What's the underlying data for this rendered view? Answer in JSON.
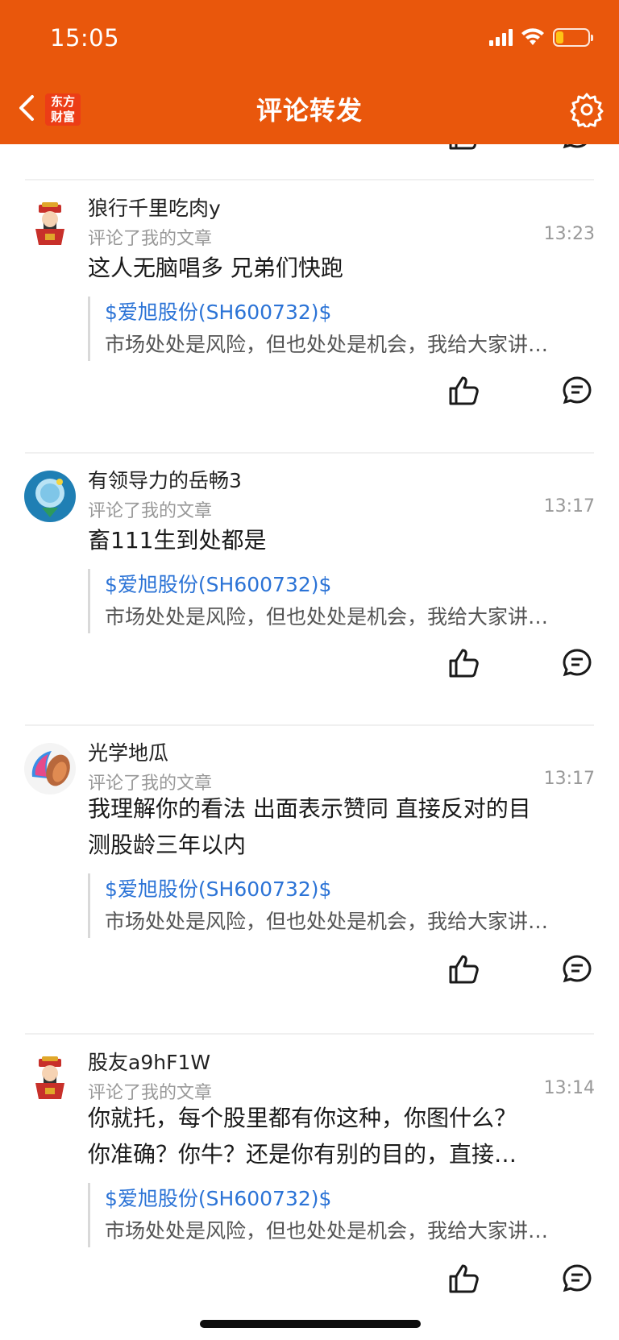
{
  "status_bar": {
    "time": "15:05"
  },
  "header": {
    "logo_line1": "东方",
    "logo_line2": "财富",
    "title": "评论转发"
  },
  "colors": {
    "header_bg": "#e9570c",
    "link_blue": "#2b73d6",
    "battery_low": "#ffc515"
  },
  "icons": [
    "back-icon",
    "settings-gear-icon",
    "like-thumb-icon",
    "reply-bubble-icon",
    "signal-icon",
    "wifi-icon",
    "battery-icon"
  ],
  "comments": [
    {
      "user": "狼行千里吃肉y",
      "subtitle": "评论了我的文章",
      "time": "13:23",
      "lines": [
        "这人无脑唱多 兄弟们快跑"
      ],
      "stock": "$爱旭股份(SH600732)$",
      "article_snippet": "市场处处是风险，但也处处是机会，我给大家讲…",
      "avatar": "caishen"
    },
    {
      "user": "有领导力的岳畅3",
      "subtitle": "评论了我的文章",
      "time": "13:17",
      "lines": [
        "畜111生到处都是"
      ],
      "stock": "$爱旭股份(SH600732)$",
      "article_snippet": "市场处处是风险，但也处处是机会，我给大家讲…",
      "avatar": "bubble"
    },
    {
      "user": "光学地瓜",
      "subtitle": "评论了我的文章",
      "time": "13:17",
      "lines": [
        "我理解你的看法 出面表示赞同 直接反对的目",
        "测股龄三年以内"
      ],
      "stock": "$爱旭股份(SH600732)$",
      "article_snippet": "市场处处是风险，但也处处是机会，我给大家讲…",
      "avatar": "potato"
    },
    {
      "user": "股友a9hF1W",
      "subtitle": "评论了我的文章",
      "time": "13:14",
      "lines": [
        "你就托，每个股里都有你这种，你图什么？",
        "你准确？你牛？还是你有别的目的，直接…"
      ],
      "stock": "$爱旭股份(SH600732)$",
      "article_snippet": "市场处处是风险，但也处处是机会，我给大家讲…",
      "avatar": "caishen"
    }
  ]
}
